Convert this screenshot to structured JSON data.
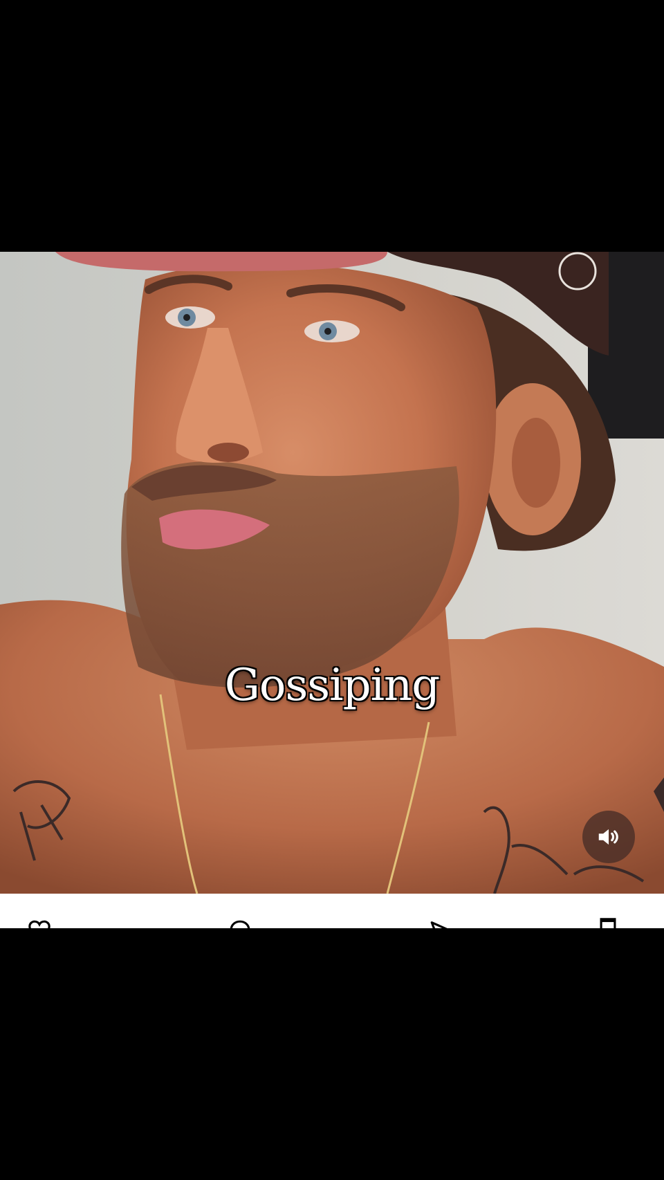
{
  "video": {
    "caption": "Gossiping",
    "sound_icon": "speaker-on-icon"
  },
  "action_bar": {
    "icons": [
      "heart-icon",
      "comment-icon",
      "share-icon",
      "bookmark-icon"
    ]
  },
  "colors": {
    "background": "#000000",
    "caption_text": "#ffffff",
    "mute_button_bg": "#462d26",
    "action_bar_bg": "#ffffff"
  }
}
